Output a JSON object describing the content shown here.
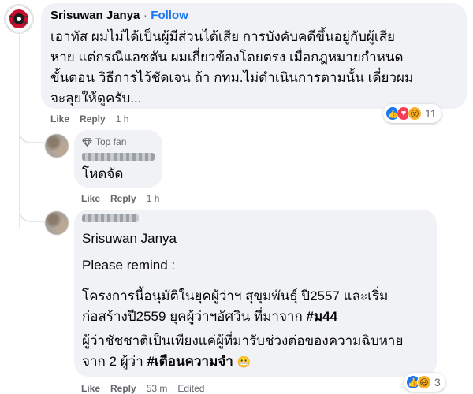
{
  "comment1": {
    "author": "Srisuwan Janya",
    "separator": "·",
    "follow_label": "Follow",
    "text_lines": [
      "เอาทัส ผมไม่ได้เป็นผู้มีส่วนได้เสีย การบังคับคดีขึ้นอยู่กับผู้เสีย",
      "หาย แต่กรณีแอชตัน ผมเกี่ยวข้องโดยตรง เมื่อกฎหมายกำหนด",
      "ขั้นตอน วิธีการไว้ชัดเจน ถ้า กทม.ไม่ดำเนินการตามนั้น เดี๋ยวผม",
      "จะลุยให้ดูครับ..."
    ],
    "reactions": {
      "icons": [
        "like-icon",
        "love-icon",
        "wow-icon"
      ],
      "count": "11"
    },
    "actions": {
      "like": "Like",
      "reply": "Reply",
      "time": "1 h"
    }
  },
  "reply1": {
    "badge_icon": "diamond-icon",
    "badge_label": "Top fan",
    "text": "โหดจัด",
    "actions": {
      "like": "Like",
      "reply": "Reply",
      "time": "1 h"
    }
  },
  "reply2": {
    "mention": "Srisuwan Janya",
    "line1": "Please remind :",
    "para1_line1": "โครงการนี้อนุมัติในยุคผู้ว่าฯ สุขุมพันธุ์ ปี2557 และเริ่ม",
    "para1_line2_text": "ก่อสร้างปี2559 ยุคผู้ว่าฯอัศวิน ที่มาจาก ",
    "para1_hashtag": "#ม44",
    "para2_line1": "ผู้ว่าชัชชาติเป็นเพียงแค่ผู้ที่มารับช่วงต่อของความฉิบหาย",
    "para2_line2_text": "จาก 2 ผู้ว่า ",
    "para2_hashtag": "#เตือนความจำ",
    "para2_emoji": "😬",
    "reactions": {
      "icons": [
        "like-icon",
        "haha-icon"
      ],
      "count": "3"
    },
    "actions": {
      "like": "Like",
      "reply": "Reply",
      "time": "53 m",
      "edited": "Edited"
    }
  }
}
